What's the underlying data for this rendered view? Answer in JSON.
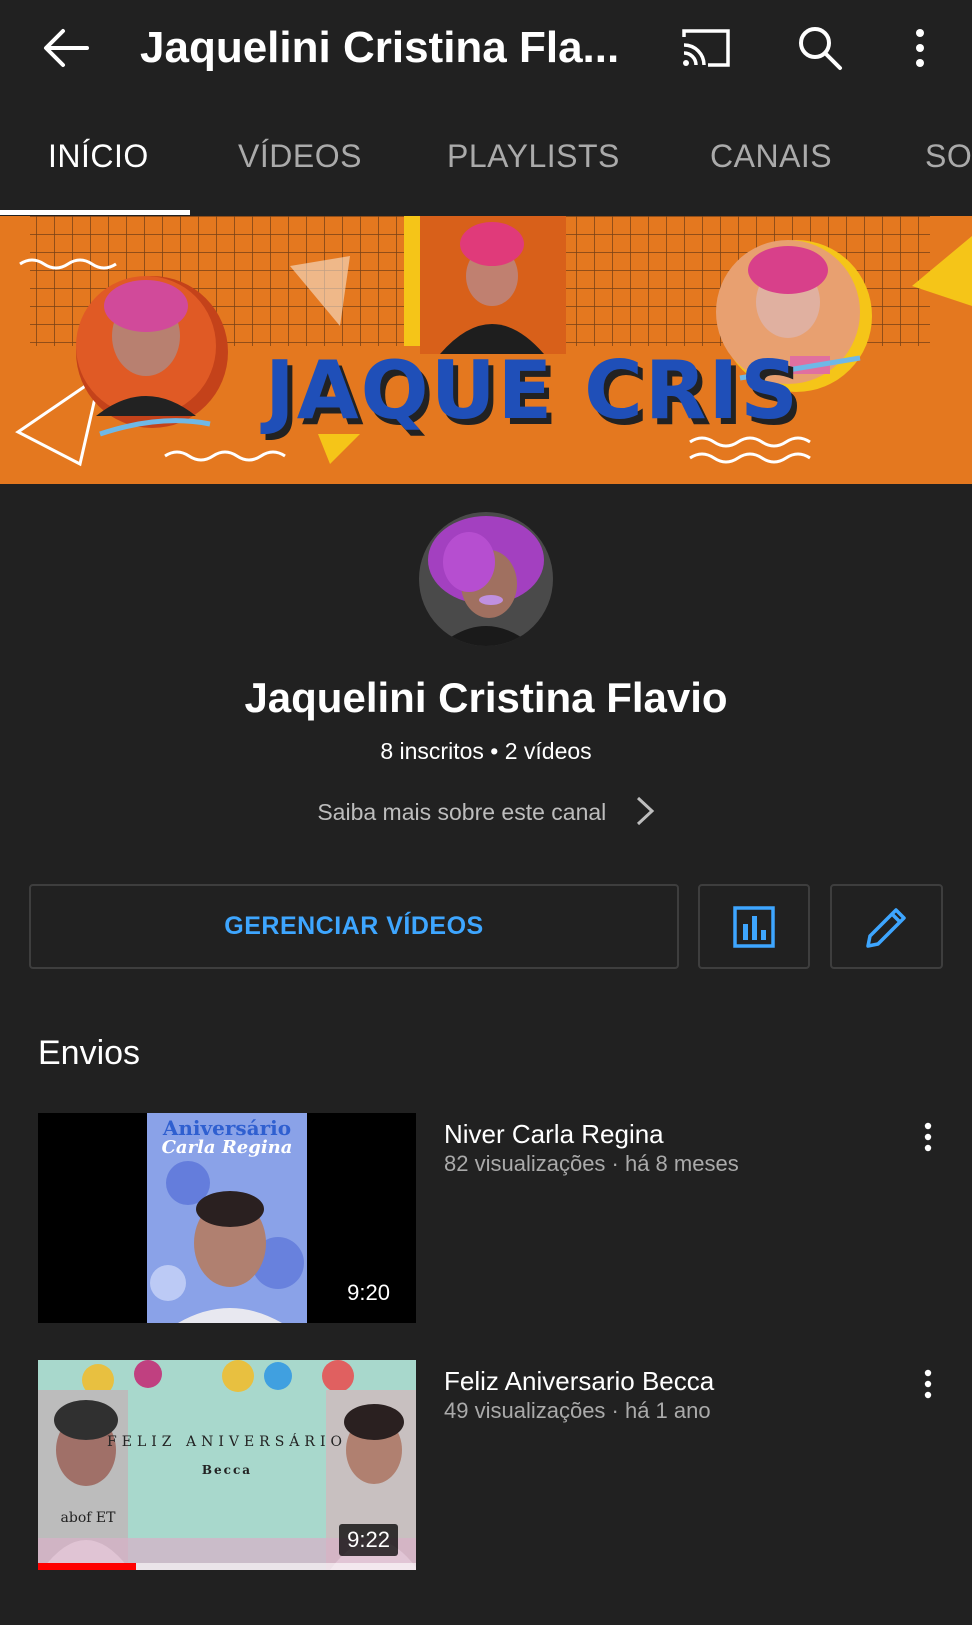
{
  "appbar": {
    "title": "Jaquelini Cristina Fla...",
    "back_icon": "arrow-left-icon",
    "cast_icon": "cast-icon",
    "search_icon": "search-icon",
    "more_icon": "more-vert-icon"
  },
  "tabs": [
    {
      "label": "INÍCIO",
      "active": true
    },
    {
      "label": "VÍDEOS",
      "active": false
    },
    {
      "label": "PLAYLISTS",
      "active": false
    },
    {
      "label": "CANAIS",
      "active": false
    },
    {
      "label": "SOBRE",
      "active": false
    }
  ],
  "banner": {
    "text": "JAQUE CRIS"
  },
  "channel": {
    "name": "Jaquelini Cristina Flavio",
    "stats": "8 inscritos • 2 vídeos",
    "about_link": "Saiba mais sobre este canal"
  },
  "actions": {
    "manage_label": "GERENCIAR VÍDEOS",
    "analytics_icon": "analytics-icon",
    "edit_icon": "pencil-icon"
  },
  "uploads": {
    "section_title": "Envios",
    "videos": [
      {
        "title": "Niver Carla Regina",
        "meta": "82 visualizações · há 8 meses",
        "duration": "9:20",
        "thumb_text_1": "Aniversário",
        "thumb_text_2": "Carla Regina",
        "watched_fraction": 0
      },
      {
        "title": "Feliz Aniversario Becca",
        "meta": "49 visualizações · há 1 ano",
        "duration": "9:22",
        "thumb_text_1": "FELIZ ANIVERSÁRIO",
        "thumb_text_2": "Becca",
        "thumb_text_3": "abof ET",
        "watched_fraction": 0.26
      }
    ]
  },
  "colors": {
    "background": "#212121",
    "accent_blue": "#3ea6ff",
    "banner_orange": "#e4781f",
    "banner_text_blue": "#1f4fb8",
    "progress_red": "#ff0000"
  }
}
